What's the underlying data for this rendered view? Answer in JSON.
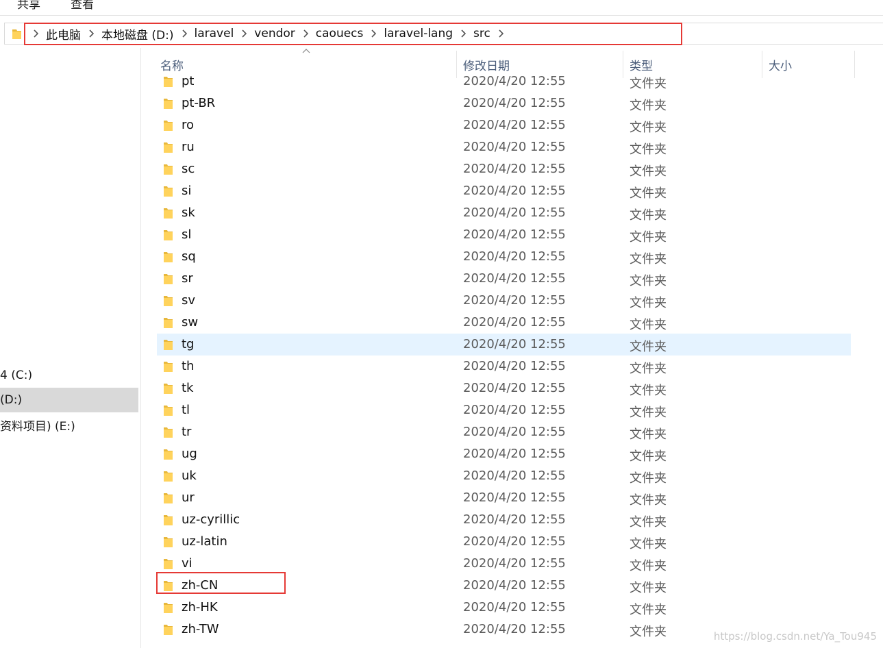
{
  "ribbon": {
    "tabs": [
      "共享",
      "查看"
    ]
  },
  "address_bar": {
    "crumbs": [
      "此电脑",
      "本地磁盘 (D:)",
      "laravel",
      "vendor",
      "caouecs",
      "laravel-lang",
      "src"
    ]
  },
  "nav_pane": {
    "items": [
      {
        "label": "4 (C:)",
        "selected": false
      },
      {
        "label": "(D:)",
        "selected": true
      },
      {
        "label": "资料项目) (E:)",
        "selected": false
      }
    ]
  },
  "columns": {
    "name": "名称",
    "date": "修改日期",
    "type": "类型",
    "size": "大小"
  },
  "rows": [
    {
      "name": "pt",
      "date": "2020/4/20 12:55",
      "type": "文件夹"
    },
    {
      "name": "pt-BR",
      "date": "2020/4/20 12:55",
      "type": "文件夹"
    },
    {
      "name": "ro",
      "date": "2020/4/20 12:55",
      "type": "文件夹"
    },
    {
      "name": "ru",
      "date": "2020/4/20 12:55",
      "type": "文件夹"
    },
    {
      "name": "sc",
      "date": "2020/4/20 12:55",
      "type": "文件夹"
    },
    {
      "name": "si",
      "date": "2020/4/20 12:55",
      "type": "文件夹"
    },
    {
      "name": "sk",
      "date": "2020/4/20 12:55",
      "type": "文件夹"
    },
    {
      "name": "sl",
      "date": "2020/4/20 12:55",
      "type": "文件夹"
    },
    {
      "name": "sq",
      "date": "2020/4/20 12:55",
      "type": "文件夹"
    },
    {
      "name": "sr",
      "date": "2020/4/20 12:55",
      "type": "文件夹"
    },
    {
      "name": "sv",
      "date": "2020/4/20 12:55",
      "type": "文件夹"
    },
    {
      "name": "sw",
      "date": "2020/4/20 12:55",
      "type": "文件夹"
    },
    {
      "name": "tg",
      "date": "2020/4/20 12:55",
      "type": "文件夹",
      "selected": true
    },
    {
      "name": "th",
      "date": "2020/4/20 12:55",
      "type": "文件夹"
    },
    {
      "name": "tk",
      "date": "2020/4/20 12:55",
      "type": "文件夹"
    },
    {
      "name": "tl",
      "date": "2020/4/20 12:55",
      "type": "文件夹"
    },
    {
      "name": "tr",
      "date": "2020/4/20 12:55",
      "type": "文件夹"
    },
    {
      "name": "ug",
      "date": "2020/4/20 12:55",
      "type": "文件夹"
    },
    {
      "name": "uk",
      "date": "2020/4/20 12:55",
      "type": "文件夹"
    },
    {
      "name": "ur",
      "date": "2020/4/20 12:55",
      "type": "文件夹"
    },
    {
      "name": "uz-cyrillic",
      "date": "2020/4/20 12:55",
      "type": "文件夹"
    },
    {
      "name": "uz-latin",
      "date": "2020/4/20 12:55",
      "type": "文件夹"
    },
    {
      "name": "vi",
      "date": "2020/4/20 12:55",
      "type": "文件夹"
    },
    {
      "name": "zh-CN",
      "date": "2020/4/20 12:55",
      "type": "文件夹",
      "highlighted": true
    },
    {
      "name": "zh-HK",
      "date": "2020/4/20 12:55",
      "type": "文件夹"
    },
    {
      "name": "zh-TW",
      "date": "2020/4/20 12:55",
      "type": "文件夹"
    }
  ],
  "watermark": "https://blog.csdn.net/Ya_Tou945",
  "colors": {
    "highlight_box": "#e53935",
    "selection": "#e5f3ff",
    "folder": "#ffd35c"
  }
}
